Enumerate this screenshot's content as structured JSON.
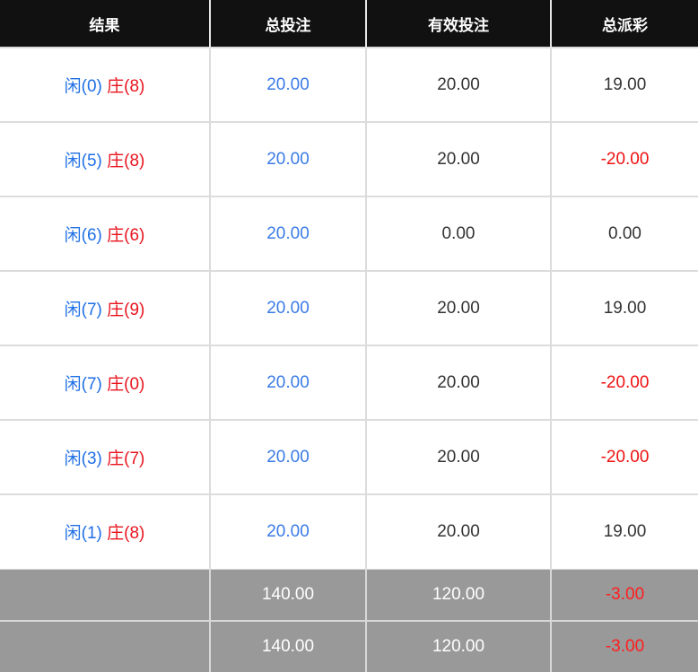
{
  "headers": {
    "result": "结果",
    "total_bet": "总投注",
    "valid_bet": "有效投注",
    "total_payout": "总派彩"
  },
  "labels": {
    "player": "闲",
    "banker": "庄"
  },
  "rows": [
    {
      "player": "(0)",
      "banker": "(8)",
      "total_bet": "20.00",
      "valid_bet": "20.00",
      "payout": "19.00",
      "payout_negative": false
    },
    {
      "player": "(5)",
      "banker": "(8)",
      "total_bet": "20.00",
      "valid_bet": "20.00",
      "payout": "-20.00",
      "payout_negative": true
    },
    {
      "player": "(6)",
      "banker": "(6)",
      "total_bet": "20.00",
      "valid_bet": "0.00",
      "payout": "0.00",
      "payout_negative": false
    },
    {
      "player": "(7)",
      "banker": "(9)",
      "total_bet": "20.00",
      "valid_bet": "20.00",
      "payout": "19.00",
      "payout_negative": false
    },
    {
      "player": "(7)",
      "banker": "(0)",
      "total_bet": "20.00",
      "valid_bet": "20.00",
      "payout": "-20.00",
      "payout_negative": true
    },
    {
      "player": "(3)",
      "banker": "(7)",
      "total_bet": "20.00",
      "valid_bet": "20.00",
      "payout": "-20.00",
      "payout_negative": true
    },
    {
      "player": "(1)",
      "banker": "(8)",
      "total_bet": "20.00",
      "valid_bet": "20.00",
      "payout": "19.00",
      "payout_negative": false
    }
  ],
  "subtotals": [
    {
      "total_bet": "140.00",
      "valid_bet": "120.00",
      "payout": "-3.00"
    },
    {
      "total_bet": "140.00",
      "valid_bet": "120.00",
      "payout": "-3.00"
    }
  ],
  "colors": {
    "header_bg": "#111111",
    "player_blue": "#1f6fe5",
    "banker_red": "#e8141e",
    "negative_red": "#ee1111",
    "footer_bg": "#999999"
  }
}
